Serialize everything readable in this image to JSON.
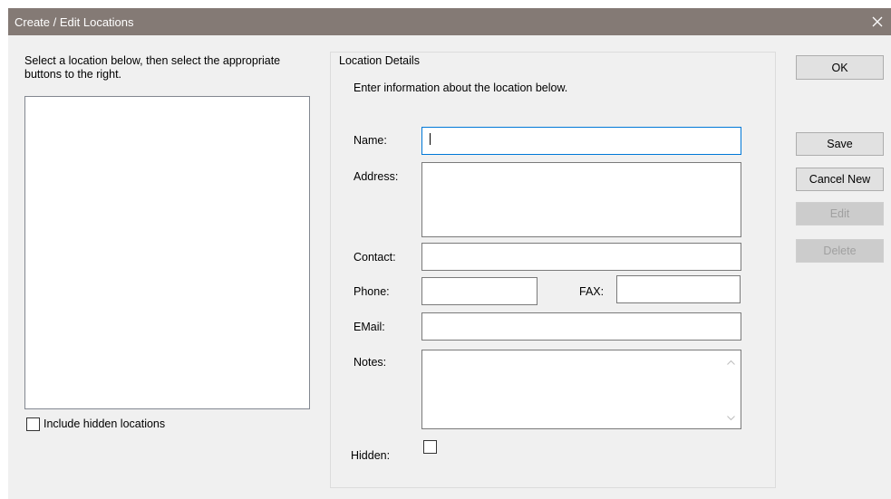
{
  "window": {
    "title": "Create / Edit Locations",
    "close_icon": "close-icon"
  },
  "left_panel": {
    "instructions": "Select a location below, then select the appropriate buttons to the right.",
    "include_hidden_label": "Include hidden locations",
    "include_hidden_checked": false
  },
  "details": {
    "group_label": "Location Details",
    "instructions": "Enter information about the location below.",
    "name_label": "Name:",
    "name_value": "",
    "address_label": "Address:",
    "address_value": "",
    "contact_label": "Contact:",
    "contact_value": "",
    "phone_label": "Phone:",
    "phone_value": "",
    "fax_label": "FAX:",
    "fax_value": "",
    "email_label": "EMail:",
    "email_value": "",
    "notes_label": "Notes:",
    "notes_value": "",
    "hidden_label": "Hidden:",
    "hidden_checked": false
  },
  "buttons": {
    "ok": "OK",
    "save": "Save",
    "cancel_new": "Cancel New",
    "edit": "Edit",
    "delete": "Delete"
  },
  "colors": {
    "titlebar": "#847a75",
    "dialog_bg": "#f0f0f0",
    "focus_border": "#0078d7"
  }
}
